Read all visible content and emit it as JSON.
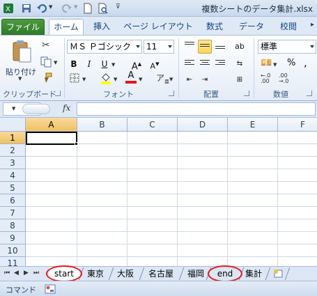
{
  "window": {
    "title": "複数シートのデータ集計.xlsx"
  },
  "ribbon_tabs": [
    "ファイル",
    "ホーム",
    "挿入",
    "ページ レイアウト",
    "数式",
    "データ",
    "校閲"
  ],
  "clipboard": {
    "paste_label": "貼り付け",
    "group_label": "クリップボード"
  },
  "font": {
    "name": "ＭＳ Ｐゴシック",
    "size": "11",
    "group_label": "フォント"
  },
  "alignment": {
    "group_label": "配置"
  },
  "number": {
    "format": "標準",
    "group_label": "数値",
    "percent": "%",
    "comma": ","
  },
  "formula_bar": {
    "fx_label": "fx",
    "name_box_value": ""
  },
  "grid": {
    "columns": [
      "A",
      "B",
      "C",
      "D",
      "E",
      "F"
    ],
    "rows": [
      "1",
      "2",
      "3",
      "4",
      "5",
      "6",
      "7",
      "8",
      "9",
      "10",
      "11"
    ],
    "active_cell": "A1"
  },
  "sheets": [
    {
      "name": "start",
      "circled": true,
      "active": true
    },
    {
      "name": "東京",
      "circled": false,
      "active": false
    },
    {
      "name": "大阪",
      "circled": false,
      "active": false
    },
    {
      "name": "名古屋",
      "circled": false,
      "active": false
    },
    {
      "name": "福岡",
      "circled": false,
      "active": false
    },
    {
      "name": "end",
      "circled": true,
      "active": false
    },
    {
      "name": "集計",
      "circled": false,
      "active": false
    }
  ],
  "status_bar": {
    "mode": "コマンド"
  },
  "colors": {
    "accent_green": "#2f7d25",
    "highlight_ring": "#e01b1b",
    "selection": "#f1c15f"
  }
}
